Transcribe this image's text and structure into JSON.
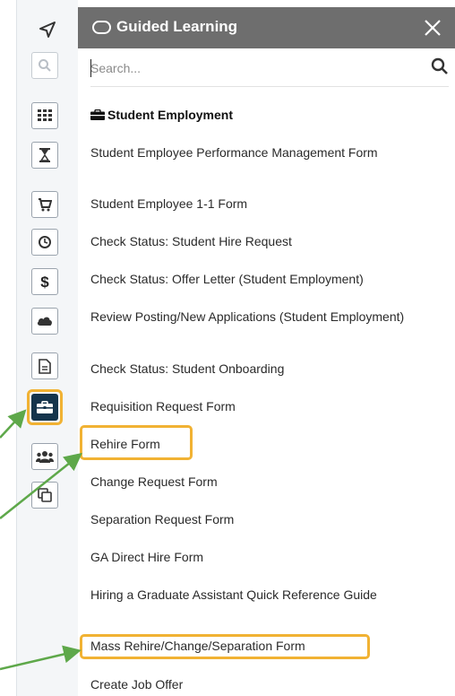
{
  "panel": {
    "title": "Guided Learning",
    "search_placeholder": "Search...",
    "section_title": "Student Employment"
  },
  "items": [
    "Student Employee Performance Management Form",
    "Student Employee 1-1 Form",
    "Check Status: Student Hire Request",
    "Check Status: Offer Letter (Student Employment)",
    "Review Posting/New Applications (Student Employment)",
    "Check Status: Student Onboarding",
    "Requisition Request Form",
    "Rehire Form",
    "Change Request Form",
    "Separation Request Form",
    "GA Direct Hire Form",
    "Hiring a Graduate Assistant Quick Reference Guide",
    "Mass Rehire/Change/Separation Form",
    "Create Job Offer"
  ],
  "rail_icons": [
    "navigation-arrow-icon",
    "search-icon",
    "grid-icon",
    "hourglass-icon",
    "cart-icon",
    "clock-icon",
    "dollar-icon",
    "cloud-icon",
    "document-icon",
    "briefcase-icon",
    "users-icon",
    "copy-icon"
  ],
  "colors": {
    "header": "#6e6e6e",
    "active_rail": "#14344c",
    "highlight": "#f1b233",
    "arrow": "#5ea84a"
  }
}
